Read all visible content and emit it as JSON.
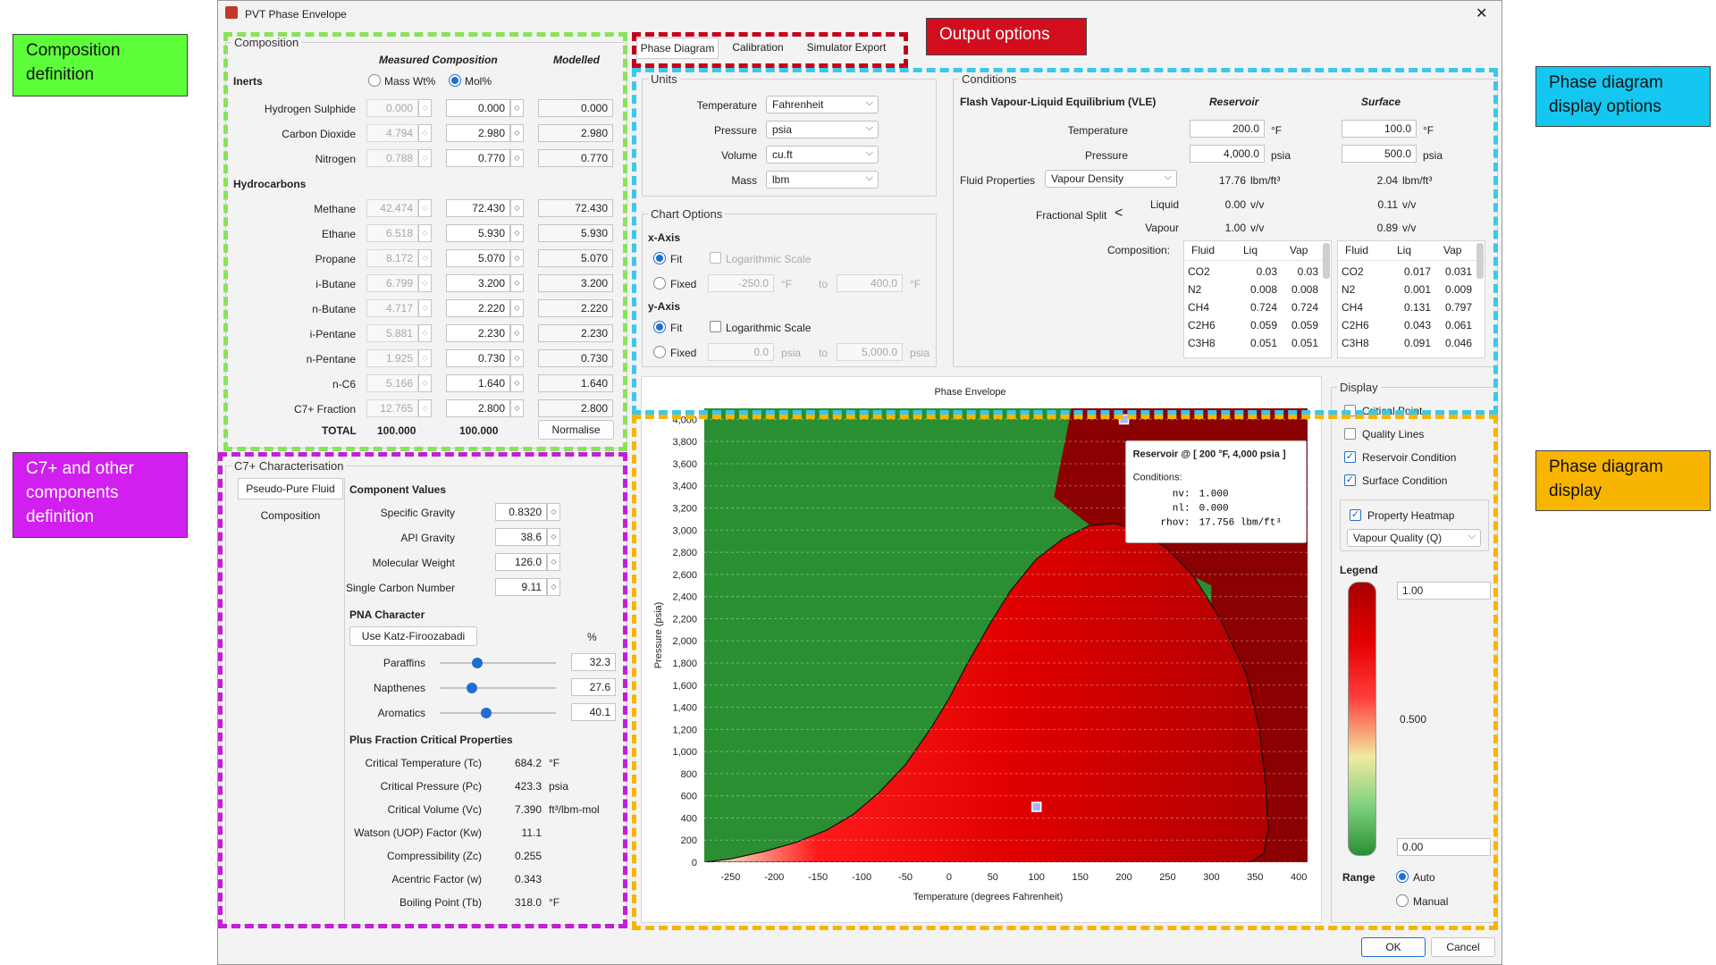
{
  "window": {
    "title": "PVT Phase Envelope",
    "close_glyph": "✕"
  },
  "annotations": {
    "composition": "Composition definition",
    "c7": "C7+ and other components definition",
    "output": "Output options",
    "pd_options": "Phase diagram display options",
    "pd_display": "Phase diagram display"
  },
  "composition": {
    "title": "Composition",
    "hdr_measured": "Measured Composition",
    "hdr_modelled": "Modelled",
    "inerts": "Inerts",
    "radio_mass": "Mass Wt%",
    "radio_mol": "Mol%",
    "hydrocarbons": "Hydrocarbons",
    "rows": [
      {
        "name": "Hydrogen Sulphide",
        "mass": "0.000",
        "mol": "0.000",
        "model": "0.000"
      },
      {
        "name": "Carbon Dioxide",
        "mass": "4.794",
        "mol": "2.980",
        "model": "2.980"
      },
      {
        "name": "Nitrogen",
        "mass": "0.788",
        "mol": "0.770",
        "model": "0.770"
      },
      {
        "name": "Methane",
        "mass": "42.474",
        "mol": "72.430",
        "model": "72.430"
      },
      {
        "name": "Ethane",
        "mass": "6.518",
        "mol": "5.930",
        "model": "5.930"
      },
      {
        "name": "Propane",
        "mass": "8.172",
        "mol": "5.070",
        "model": "5.070"
      },
      {
        "name": "i-Butane",
        "mass": "6.799",
        "mol": "3.200",
        "model": "3.200"
      },
      {
        "name": "n-Butane",
        "mass": "4.717",
        "mol": "2.220",
        "model": "2.220"
      },
      {
        "name": "i-Pentane",
        "mass": "5.881",
        "mol": "2.230",
        "model": "2.230"
      },
      {
        "name": "n-Pentane",
        "mass": "1.925",
        "mol": "0.730",
        "model": "0.730"
      },
      {
        "name": "n-C6",
        "mass": "5.166",
        "mol": "1.640",
        "model": "1.640"
      },
      {
        "name": "C7+ Fraction",
        "mass": "12.765",
        "mol": "2.800",
        "model": "2.800"
      }
    ],
    "total_label": "TOTAL",
    "total_mass": "100.000",
    "total_mol": "100.000",
    "normalise": "Normalise"
  },
  "c7": {
    "title": "C7+ Characterisation",
    "tab_pseudo": "Pseudo-Pure Fluid",
    "tab_comp": "Composition",
    "cv_title": "Component Values",
    "sg_label": "Specific Gravity",
    "sg": "0.8320",
    "api_label": "API Gravity",
    "api": "38.6",
    "mw_label": "Molecular Weight",
    "mw": "126.0",
    "scn_label": "Single Carbon Number",
    "scn": "9.11",
    "pna_title": "PNA Character",
    "pna_btn": "Use Katz-Firoozabadi",
    "pct": "%",
    "pna": [
      {
        "label": "Paraffins",
        "value": "32.3",
        "level": 0.323
      },
      {
        "label": "Napthenes",
        "value": "27.6",
        "level": 0.276
      },
      {
        "label": "Aromatics",
        "value": "40.1",
        "level": 0.401
      }
    ],
    "crit_title": "Plus Fraction Critical Properties",
    "crit": [
      {
        "label": "Critical Temperature (Tc)",
        "value": "684.2",
        "unit": "°F"
      },
      {
        "label": "Critical Pressure (Pc)",
        "value": "423.3",
        "unit": "psia"
      },
      {
        "label": "Critical Volume (Vc)",
        "value": "7.390",
        "unit": "ft³/lbm-mol"
      },
      {
        "label": "Watson (UOP) Factor (Kw)",
        "value": "11.1",
        "unit": ""
      },
      {
        "label": "Compressibility (Zc)",
        "value": "0.255",
        "unit": ""
      },
      {
        "label": "Acentric Factor (w)",
        "value": "0.343",
        "unit": ""
      },
      {
        "label": "Boiling Point (Tb)",
        "value": "318.0",
        "unit": "°F"
      }
    ]
  },
  "tabs": [
    "Phase Diagram",
    "Calibration",
    "Simulator Export"
  ],
  "units": {
    "title": "Units",
    "temp_label": "Temperature",
    "temp": "Fahrenheit",
    "press_label": "Pressure",
    "press": "psia",
    "vol_label": "Volume",
    "vol": "cu.ft",
    "mass_label": "Mass",
    "mass": "lbm"
  },
  "chart_options": {
    "title": "Chart Options",
    "x_axis": "x-Axis",
    "y_axis": "y-Axis",
    "fit": "Fit",
    "fixed": "Fixed",
    "log": "Logarithmic Scale",
    "to": "to",
    "x_min": "-250.0",
    "x_max": "400.0",
    "x_unit": "°F",
    "y_min": "0.0",
    "y_max": "5,000.0",
    "y_unit": "psia"
  },
  "conditions": {
    "title": "Conditions",
    "flash": "Flash Vapour-Liquid Equilibrium (VLE)",
    "reservoir": "Reservoir",
    "surface": "Surface",
    "temp_label": "Temperature",
    "press_label": "Pressure",
    "res_temp": "200.0",
    "res_press": "4,000.0",
    "surf_temp": "100.0",
    "surf_press": "500.0",
    "unit_f": "°F",
    "unit_psia": "psia",
    "fluid_props_label": "Fluid Properties",
    "fluid_prop": "Vapour Density",
    "res_density": "17.76",
    "surf_density": "2.04",
    "density_unit": "lbm/ft³",
    "split_label": "Fractional Split",
    "liquid": "Liquid",
    "vapour": "Vapour",
    "res_liq": "0.00",
    "res_vap": "1.00",
    "surf_liq": "0.11",
    "surf_vap": "0.89",
    "vv": "v/v",
    "comp_label": "Composition:",
    "th_fluid": "Fluid",
    "th_liq": "Liq",
    "th_vap": "Vap",
    "res_rows": [
      [
        "CO2",
        "0.03",
        "0.03"
      ],
      [
        "N2",
        "0.008",
        "0.008"
      ],
      [
        "CH4",
        "0.724",
        "0.724"
      ],
      [
        "C2H6",
        "0.059",
        "0.059"
      ],
      [
        "C3H8",
        "0.051",
        "0.051"
      ]
    ],
    "surf_rows": [
      [
        "CO2",
        "0.017",
        "0.031"
      ],
      [
        "N2",
        "0.001",
        "0.009"
      ],
      [
        "CH4",
        "0.131",
        "0.797"
      ],
      [
        "C2H6",
        "0.043",
        "0.061"
      ],
      [
        "C3H8",
        "0.091",
        "0.046"
      ]
    ]
  },
  "chart": {
    "title": "Phase Envelope",
    "tooltip_title": "Reservoir @ [ 200 °F, 4,000 psia ]",
    "tooltip_cond": "Conditions:",
    "tooltip_lines": [
      {
        "k": "nv:",
        "v": "1.000"
      },
      {
        "k": "nl:",
        "v": "0.000"
      },
      {
        "k": "rhov:",
        "v": "17.756 lbm/ft³"
      }
    ]
  },
  "display": {
    "title": "Display",
    "critical_point": "Critical Point",
    "quality_lines": "Quality Lines",
    "reservoir_cond": "Reservoir Condition",
    "surface_cond": "Surface Condition",
    "heatmap": "Property Heatmap",
    "heatmap_prop": "Vapour Quality (Q)",
    "legend": "Legend",
    "leg_max": "1.00",
    "leg_mid": "0.500",
    "leg_min": "0.00",
    "range": "Range",
    "auto": "Auto",
    "manual": "Manual"
  },
  "buttons": {
    "ok": "OK",
    "cancel": "Cancel"
  },
  "chart_data": {
    "type": "heatmap",
    "title": "Phase Envelope",
    "xlabel": "Temperature (degrees Fahrenheit)",
    "ylabel": "Pressure (psia)",
    "xlim": [
      -280,
      410
    ],
    "ylim": [
      0,
      4100
    ],
    "xticks": [
      -250,
      -200,
      -150,
      -100,
      -50,
      0,
      50,
      100,
      150,
      200,
      250,
      300,
      350,
      400
    ],
    "yticks": [
      0,
      200,
      400,
      600,
      800,
      1000,
      1200,
      1400,
      1600,
      1800,
      2000,
      2200,
      2400,
      2600,
      2800,
      3000,
      3200,
      3400,
      3600,
      3800,
      4000
    ],
    "envelope": {
      "x": [
        -280,
        -250,
        -210,
        -175,
        -140,
        -110,
        -80,
        -50,
        -20,
        0,
        20,
        45,
        70,
        100,
        130,
        160,
        190,
        220,
        250,
        280,
        310,
        340,
        355,
        362,
        365,
        360,
        345
      ],
      "y": [
        0,
        30,
        100,
        180,
        290,
        430,
        630,
        880,
        1220,
        1480,
        1780,
        2130,
        2450,
        2740,
        2920,
        3040,
        3060,
        2990,
        2830,
        2580,
        2200,
        1700,
        1200,
        700,
        300,
        80,
        0
      ]
    },
    "reservoir_point": {
      "x": 200,
      "y": 4000
    },
    "surface_point": {
      "x": 100,
      "y": 500
    },
    "colors": {
      "vapour": "#2a8f32",
      "two_phase_high": "#8b0000",
      "two_phase_low": "#ff1a1a",
      "near_dew": "#f2f0b0"
    }
  }
}
